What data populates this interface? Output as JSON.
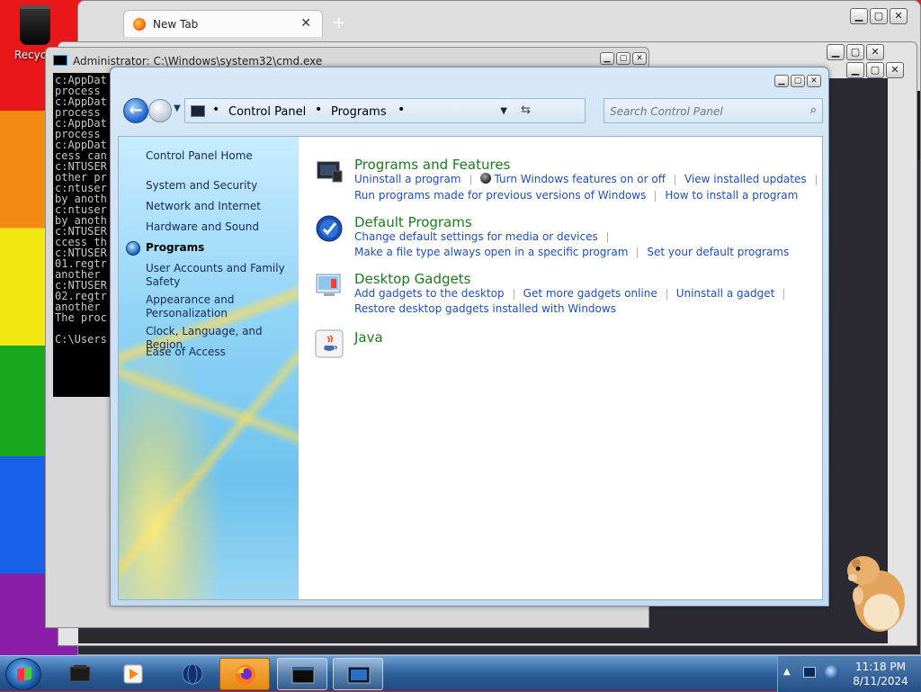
{
  "desktop": {
    "recycle_bin_label": "Recycle"
  },
  "browser": {
    "tab_title": "New Tab",
    "tab_close": "✕",
    "new_tab": "+",
    "extensions_icon": "puzzle-icon",
    "menu_icon": "☰",
    "settings_icon": "⚙"
  },
  "cmd": {
    "title": "Administrator: C:\\Windows\\system32\\cmd.exe",
    "lines": [
      "c:AppDat",
      "process",
      "c:AppDat",
      "process",
      "c:AppDat",
      " process",
      "c:AppDat",
      "cess can",
      "c:NTUSER",
      "other pr",
      "c:ntuser",
      "by anoth",
      "c:ntuser",
      "by anoth",
      "c:NTUSER",
      "ccess th",
      "c:NTUSER",
      "01.regtr",
      "another",
      "c:NTUSER",
      "02.regtr",
      "another",
      "The proc",
      "",
      "C:\\Users"
    ]
  },
  "control_panel": {
    "address": {
      "crumbs": [
        "Control Panel",
        "Programs"
      ],
      "separator": "•"
    },
    "search_placeholder": "Search Control Panel",
    "sidebar": {
      "items": [
        {
          "label": "Control Panel Home"
        },
        {
          "label": "System and Security"
        },
        {
          "label": "Network and Internet"
        },
        {
          "label": "Hardware and Sound"
        },
        {
          "label": "Programs"
        },
        {
          "label": "User Accounts and Family Safety"
        },
        {
          "label": "Appearance and Personalization"
        },
        {
          "label": "Clock, Language, and Region"
        },
        {
          "label": "Ease of Access"
        }
      ],
      "active_index": 4
    },
    "categories": [
      {
        "title": "Programs and Features",
        "icon": "programs-features-icon",
        "lines": [
          [
            "Uninstall a program",
            "Turn Windows features on or off",
            "View installed updates"
          ],
          [
            "Run programs made for previous versions of Windows",
            "How to install a program"
          ]
        ]
      },
      {
        "title": "Default Programs",
        "icon": "default-programs-icon",
        "lines": [
          [
            "Change default settings for media or devices"
          ],
          [
            "Make a file type always open in a specific program",
            "Set your default programs"
          ]
        ]
      },
      {
        "title": "Desktop Gadgets",
        "icon": "desktop-gadgets-icon",
        "lines": [
          [
            "Add gadgets to the desktop",
            "Get more gadgets online",
            "Uninstall a gadget"
          ],
          [
            "Restore desktop gadgets installed with Windows"
          ]
        ]
      },
      {
        "title": "Java",
        "icon": "java-icon",
        "lines": []
      }
    ]
  },
  "taskbar": {
    "time": "11:18 PM",
    "date": "8/11/2024"
  }
}
